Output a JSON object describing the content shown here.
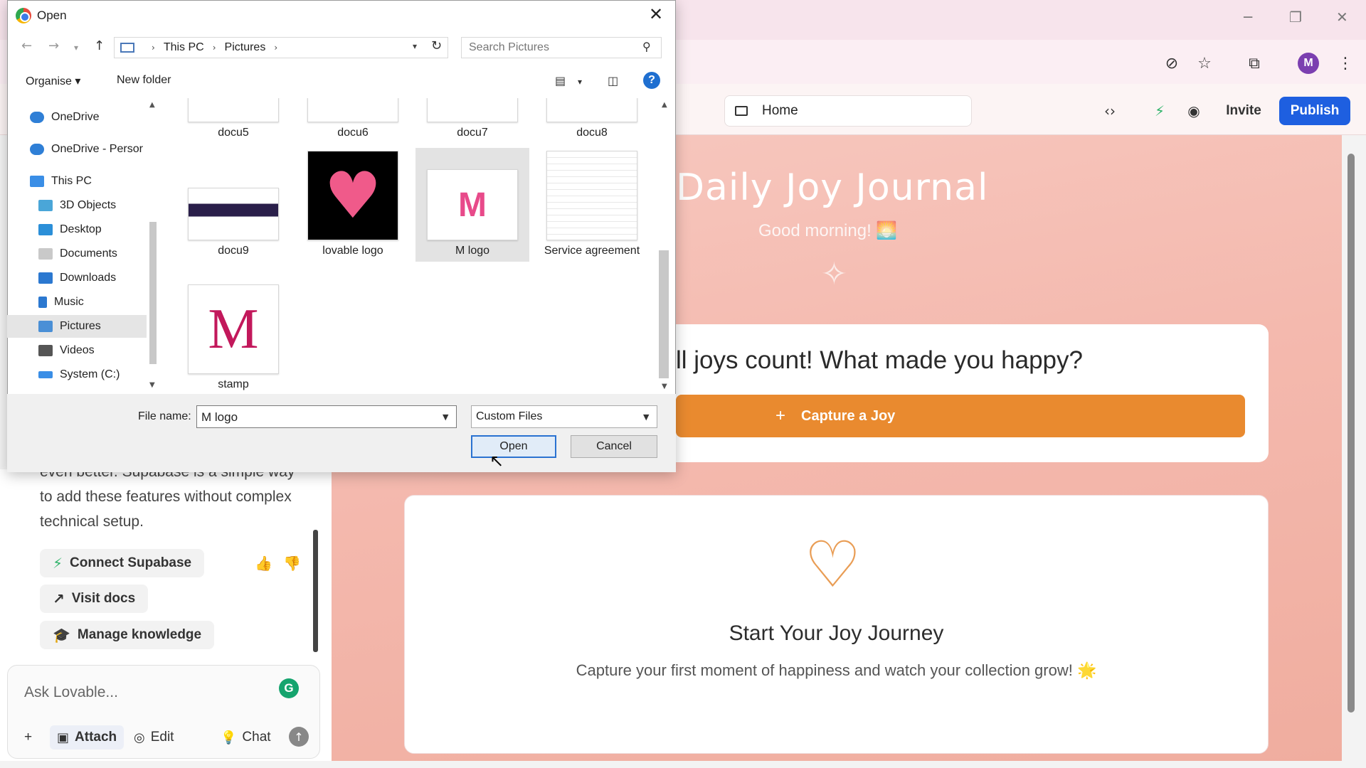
{
  "browser": {
    "controls": {
      "minimize": "─",
      "restore": "❐",
      "close": "✕"
    },
    "avatar_letter": "M"
  },
  "app_header": {
    "home_label": "Home",
    "invite_label": "Invite",
    "publish_label": "Publish"
  },
  "preview": {
    "title": "Daily Joy Journal",
    "subtitle": "Good morning! 🌅",
    "prompt": "ll joys count! What made you happy?",
    "capture_label": "Capture a Joy",
    "empty_title": "Start Your Joy Journey",
    "empty_desc": "Capture your first moment of happiness and watch your collection grow! 🌟",
    "accent_color": "#e98a2f"
  },
  "chat": {
    "message_text": "even better. Supabase is a simple way to add these features without complex technical setup.",
    "buttons": {
      "connect": "Connect Supabase",
      "docs": "Visit docs",
      "knowledge": "Manage knowledge"
    },
    "input_placeholder": "Ask Lovable...",
    "tools": {
      "attach": "Attach",
      "edit": "Edit",
      "chat": "Chat"
    }
  },
  "dialog": {
    "title": "Open",
    "breadcrumb": [
      "This PC",
      "Pictures"
    ],
    "search_placeholder": "Search Pictures",
    "organise_label": "Organise ▾",
    "new_folder_label": "New folder",
    "help_label": "?",
    "tree": [
      {
        "label": "OneDrive",
        "color": "#2f7fd6"
      },
      {
        "label": "OneDrive - Persor",
        "color": "#2f7fd6"
      },
      {
        "label": "This PC",
        "color": "#3a8ee6"
      },
      {
        "label": "3D Objects",
        "color": "#4aa6d8"
      },
      {
        "label": "Desktop",
        "color": "#2b8fd8"
      },
      {
        "label": "Documents",
        "color": "#8a8a8a"
      },
      {
        "label": "Downloads",
        "color": "#2b78d0"
      },
      {
        "label": "Music",
        "color": "#2b78d0"
      },
      {
        "label": "Pictures",
        "color": "#4a8fd6"
      },
      {
        "label": "Videos",
        "color": "#555555"
      },
      {
        "label": "System (C:)",
        "color": "#3a8ee6"
      }
    ],
    "files_row1": [
      "docu5",
      "docu6",
      "docu7",
      "docu8"
    ],
    "files_row2": [
      "docu9",
      "lovable logo",
      "M logo",
      "Service agreement"
    ],
    "files_row3": [
      "stamp"
    ],
    "file_name_label": "File name:",
    "file_name_value": "M logo",
    "file_type": "Custom Files",
    "open_label": "Open",
    "cancel_label": "Cancel"
  }
}
